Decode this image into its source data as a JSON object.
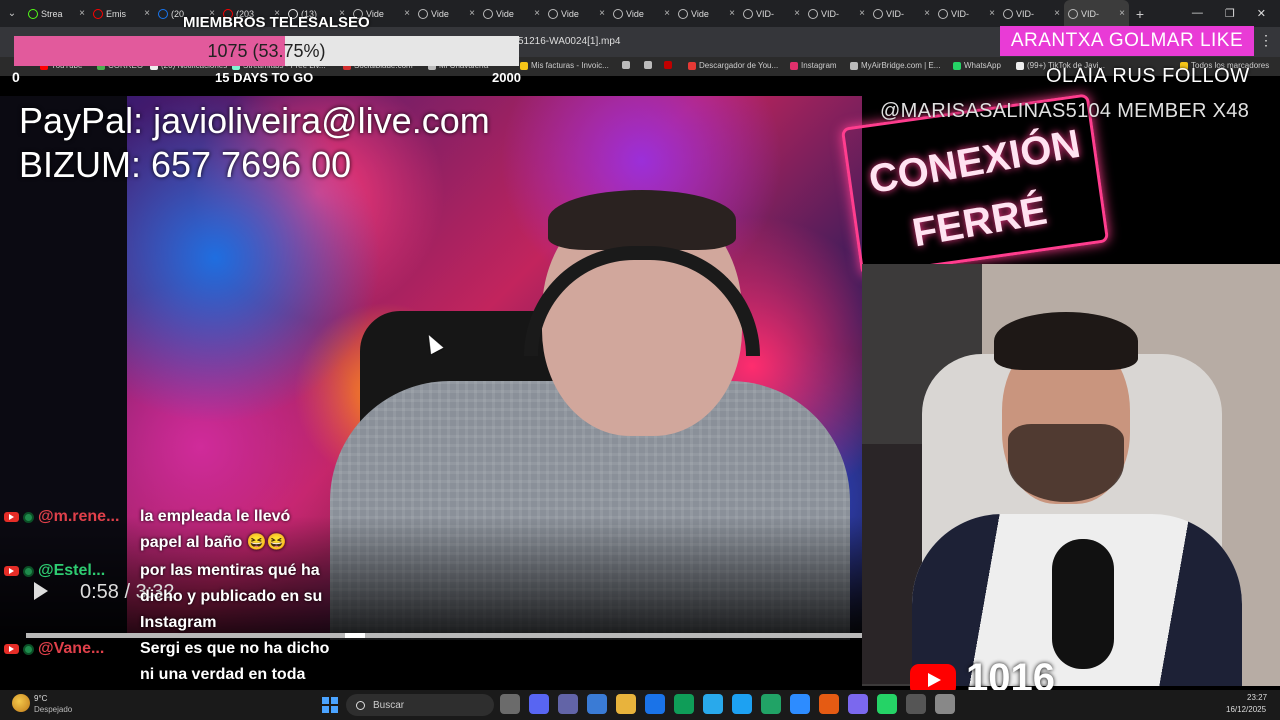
{
  "browser": {
    "tabs": [
      {
        "label": "Strea",
        "color": "#53fc18"
      },
      {
        "label": "Emis",
        "color": "#ff0000"
      },
      {
        "label": "(20",
        "color": "#1877f2"
      },
      {
        "label": "(203",
        "color": "#ff0000"
      },
      {
        "label": "(13)",
        "color": "#eeeeee"
      },
      {
        "label": "Vide",
        "color": "#bbbbbb"
      },
      {
        "label": "Vide",
        "color": "#bbbbbb"
      },
      {
        "label": "Vide",
        "color": "#bbbbbb"
      },
      {
        "label": "Vide",
        "color": "#bbbbbb"
      },
      {
        "label": "Vide",
        "color": "#bbbbbb"
      },
      {
        "label": "Vide",
        "color": "#bbbbbb"
      },
      {
        "label": "VID-",
        "color": "#bbbbbb"
      },
      {
        "label": "VID-",
        "color": "#bbbbbb"
      },
      {
        "label": "VID-",
        "color": "#bbbbbb"
      },
      {
        "label": "VID-",
        "color": "#bbbbbb"
      },
      {
        "label": "VID-",
        "color": "#bbbbbb"
      },
      {
        "label": "VID-",
        "color": "#bbbbbb"
      }
    ],
    "tab_close": "×",
    "new_tab": "+",
    "window_controls": [
      "—",
      "❐",
      "✕"
    ],
    "address": "51216-WA0024[1].mp4",
    "bookmarks": [
      {
        "label": "YouTube",
        "color": "#ff0000"
      },
      {
        "label": "CORREO",
        "color": "#4caf50"
      },
      {
        "label": "(20) Notificaciones",
        "color": "#eeeeee"
      },
      {
        "label": "Streamlabs - Free Liv...",
        "color": "#80f5d2"
      },
      {
        "label": "Socialblade.com",
        "color": "#d32f2f"
      },
      {
        "label": "Mi Chavalería",
        "color": "#bbbbbb"
      },
      {
        "label": "Mis facturas - Invoic...",
        "color": "#f5c518"
      },
      {
        "label": "",
        "color": "#bbbbbb"
      },
      {
        "label": "",
        "color": "#bbbbbb"
      },
      {
        "label": "",
        "color": "#c00000"
      },
      {
        "label": "Descargador de You...",
        "color": "#e53935"
      },
      {
        "label": "Instagram",
        "color": "#e1306c"
      },
      {
        "label": "MyAirBridge.com | E...",
        "color": "#bbbbbb"
      },
      {
        "label": "WhatsApp",
        "color": "#25d366"
      },
      {
        "label": "(99+) TikTok de Javi...",
        "color": "#eeeeee"
      },
      {
        "label": "Todos los marcadores",
        "color": "#f5c518"
      }
    ]
  },
  "overlay": {
    "members_title": "MIEMBROS TELESALSEO",
    "goal_text": "1075 (53.75%)",
    "goal_fraction": 0.5375,
    "goal_min": "0",
    "goal_days": "15 DAYS TO GO",
    "goal_max": "2000",
    "like_banner": "ARANTXA GOLMAR  LIKE",
    "follow_text": "OLAIA RUS  FOLLOW",
    "kebab": "⋮",
    "paypal": "PayPal: javioliveira@live.com",
    "bizum": "BIZUM: 657 7696 00",
    "member_handle": "@MARISASALINAS5104  MEMBER X48",
    "neon_line1": "CONEXIÓN",
    "neon_line2": "FERRÉ",
    "subscriber_count": "1016",
    "accent_color": "#e93bd6",
    "goal_color": "#e25a9c"
  },
  "player": {
    "time": "0:58 / 3:32",
    "progress_fraction": 0.22
  },
  "chat": [
    {
      "user": "@m.rene...",
      "text": "la empleada le llevó papel al baño 😆😆",
      "color": "#e0404a"
    },
    {
      "user": "@Estel...",
      "text": "por las mentiras qué ha dicho y publicado en su Instagram",
      "color": "#2ecc71"
    },
    {
      "user": "@Vane...",
      "text": "Sergi es que no ha dicho ni una verdad en toda esta historia",
      "color": "#e0404a"
    }
  ],
  "taskbar": {
    "weather_temp": "9°C",
    "weather_desc": "Despejado",
    "search_placeholder": "Buscar",
    "apps": [
      "#6b6b6b",
      "#5865f2",
      "#6264a7",
      "#3a7bd5",
      "#e8b33c",
      "#1a73e8",
      "#0f9d58",
      "#29a9eb",
      "#1da1f2",
      "#21a366",
      "#2d8cff",
      "#e55b13",
      "#7b68ee",
      "#25d366",
      "#555555",
      "#888888"
    ],
    "clock_time": "23:27",
    "clock_date": "16/12/2025"
  }
}
